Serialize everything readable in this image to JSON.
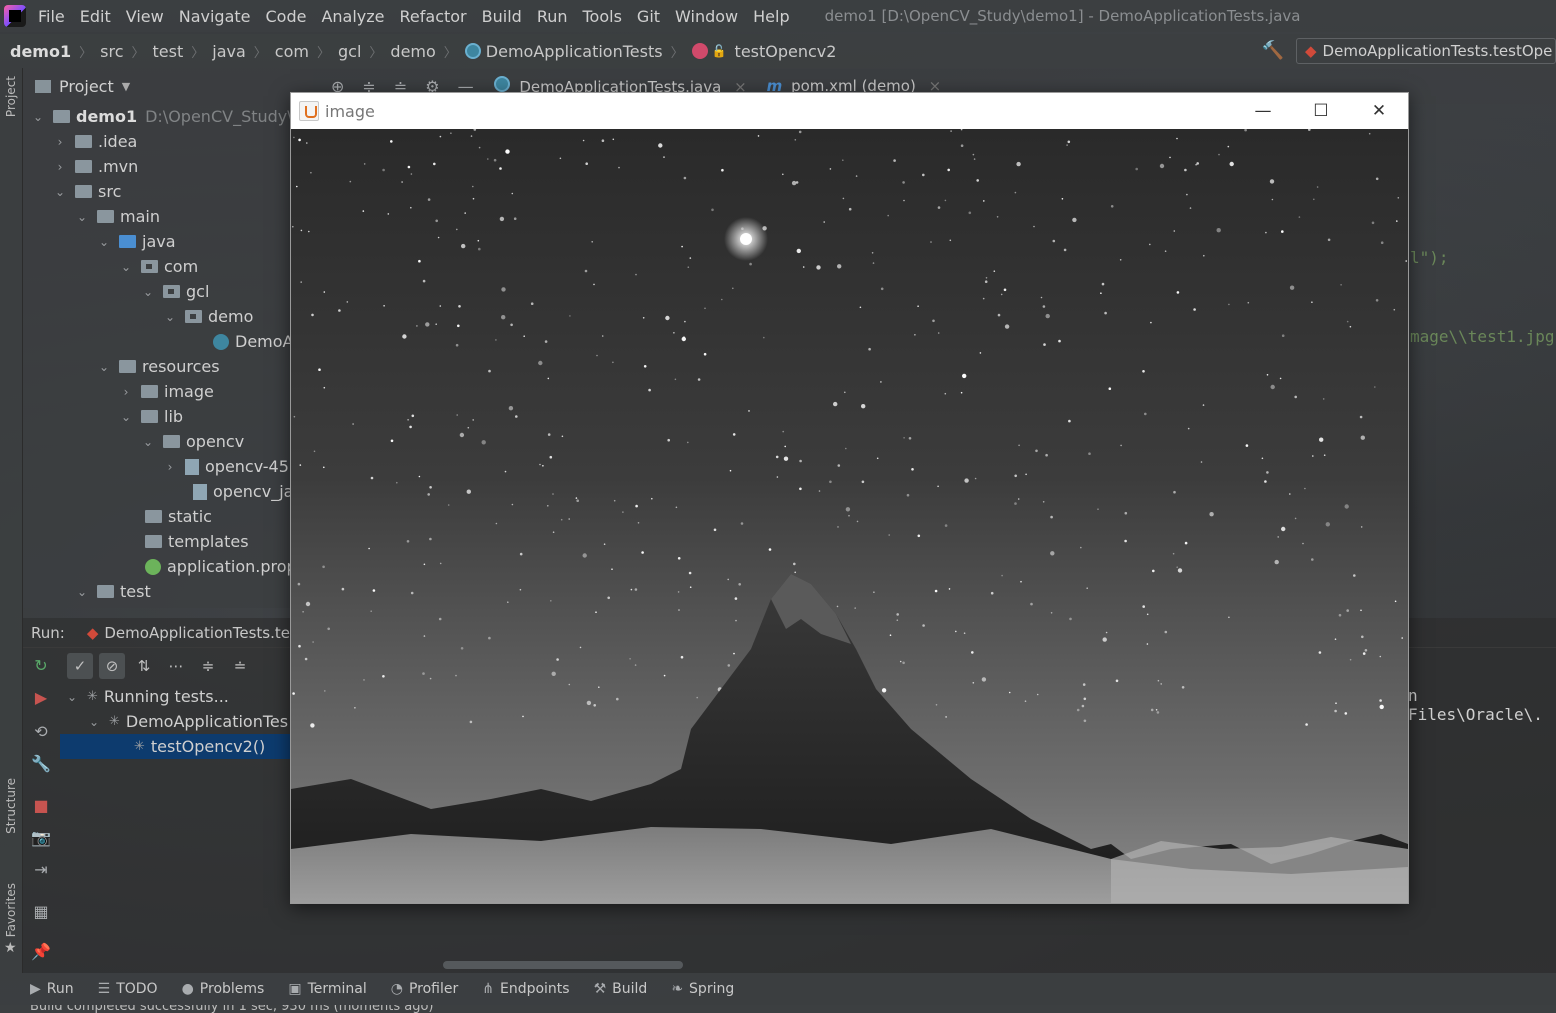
{
  "menubar": {
    "items": [
      "File",
      "Edit",
      "View",
      "Navigate",
      "Code",
      "Analyze",
      "Refactor",
      "Build",
      "Run",
      "Tools",
      "Git",
      "Window",
      "Help"
    ],
    "window_title": "demo1 [D:\\OpenCV_Study\\demo1] - DemoApplicationTests.java"
  },
  "breadcrumb": {
    "items": [
      "demo1",
      "src",
      "test",
      "java",
      "com",
      "gcl",
      "demo",
      "DemoApplicationTests",
      "testOpencv2"
    ],
    "run_config": "DemoApplicationTests.testOpe"
  },
  "project_panel": {
    "title": "Project",
    "root_name": "demo1",
    "root_path": "D:\\OpenCV_Study\\de",
    "tree": [
      {
        "label": ".idea"
      },
      {
        "label": ".mvn"
      },
      {
        "label": "src"
      },
      {
        "label": "main"
      },
      {
        "label": "java"
      },
      {
        "label": "com"
      },
      {
        "label": "gcl"
      },
      {
        "label": "demo"
      },
      {
        "label": "DemoA"
      },
      {
        "label": "resources"
      },
      {
        "label": "image"
      },
      {
        "label": "lib"
      },
      {
        "label": "opencv"
      },
      {
        "label": "opencv-45"
      },
      {
        "label": "opencv_jav"
      },
      {
        "label": "static"
      },
      {
        "label": "templates"
      },
      {
        "label": "application.prop"
      },
      {
        "label": "test"
      }
    ]
  },
  "editor": {
    "tabs": [
      {
        "label": "DemoApplicationTests.java"
      },
      {
        "label": "pom.xml (demo)"
      }
    ],
    "code_fragments": {
      "line1": "l\");",
      "line2": "mage\\\\test1.jpg",
      "console": "n Files\\Oracle\\."
    }
  },
  "run_panel": {
    "label": "Run:",
    "config": "DemoApplicationTests.te",
    "tree": [
      {
        "label": "Running tests..."
      },
      {
        "label": "DemoApplicationTes"
      },
      {
        "label": "testOpencv2()"
      }
    ]
  },
  "image_window": {
    "title": "image"
  },
  "bottom_tools": [
    "Run",
    "TODO",
    "Problems",
    "Terminal",
    "Profiler",
    "Endpoints",
    "Build",
    "Spring"
  ],
  "status": {
    "text": "Build completed successfully in 1 sec, 930 ms (moments ago)"
  },
  "stripe_labels": {
    "project": "Project",
    "structure": "Structure",
    "favorites": "Favorites"
  },
  "colors": {
    "accent": "#4a8ed1",
    "selection": "#0d3b6e",
    "run_green": "#59a869",
    "stop_red": "#c75450",
    "test_fail": "#c75450"
  }
}
